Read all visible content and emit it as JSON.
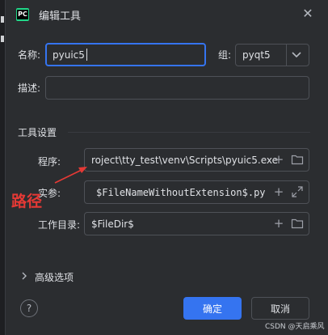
{
  "dialog": {
    "title": "编辑工具",
    "logo_text": "PC"
  },
  "name_field": {
    "label": "名称:",
    "value": "pyuic5"
  },
  "group_field": {
    "label": "组:",
    "value": "pyqt5"
  },
  "description_field": {
    "label": "描述:",
    "value": ""
  },
  "tool_settings": {
    "heading": "工具设置",
    "program": {
      "label": "程序:",
      "value": "roject\\tty_test\\venv\\Scripts\\pyuic5.exe"
    },
    "arguments": {
      "label": "实参:",
      "value": "$FileNameWithoutExtension$.py"
    },
    "working_dir": {
      "label": "工作目录:",
      "value": "$FileDir$"
    }
  },
  "advanced": {
    "label": "高级选项"
  },
  "buttons": {
    "ok": "确定",
    "cancel": "取消",
    "help": "?"
  },
  "annotation": {
    "text": "路径",
    "color": "#e53935"
  },
  "watermark": "CSDN @天启乘风",
  "colors": {
    "accent": "#3574f0",
    "background": "#2b2d30",
    "annotation": "#e53935"
  },
  "icons": [
    "pycharm-logo-icon",
    "close-icon",
    "chevron-down-icon",
    "plus-icon",
    "folder-icon",
    "expand-icon",
    "chevron-right-icon",
    "help-icon"
  ]
}
